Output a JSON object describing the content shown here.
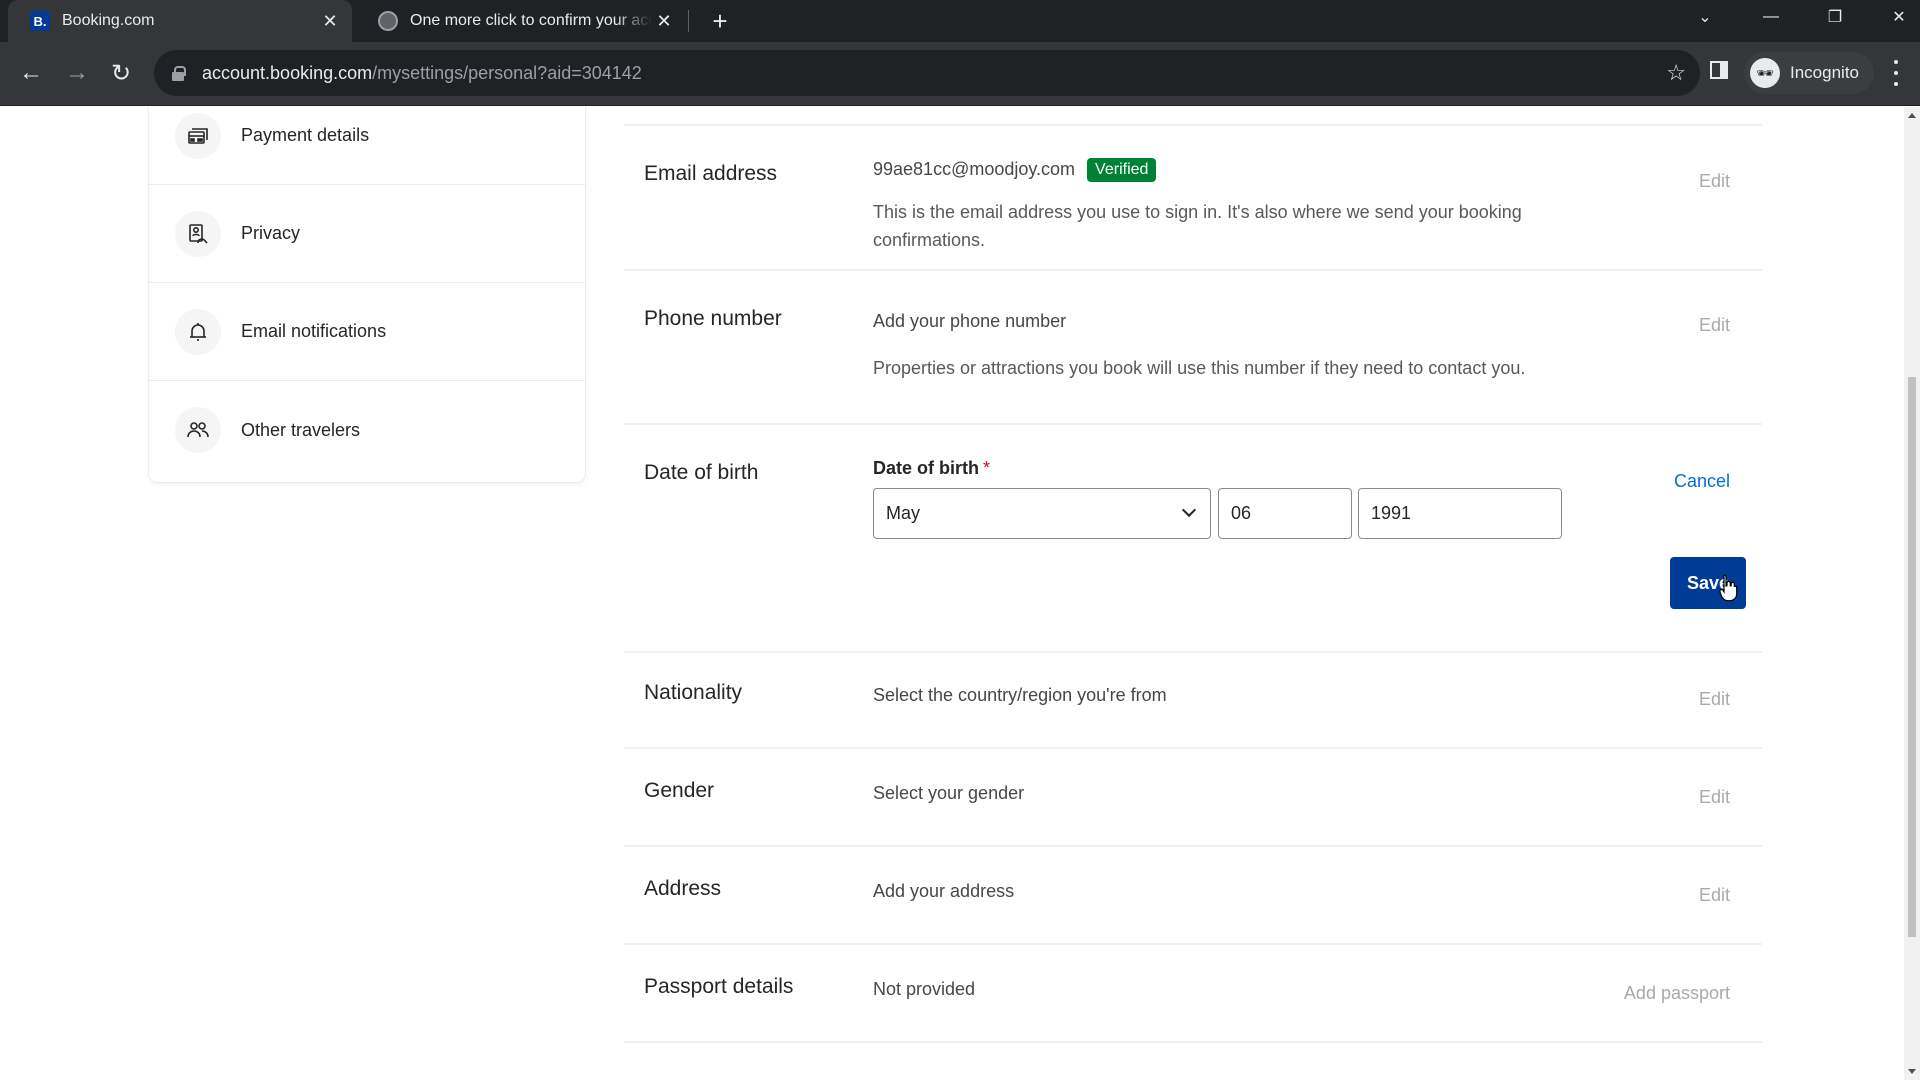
{
  "browser": {
    "tabs": [
      {
        "title": "Booking.com",
        "favicon": "B.",
        "active": true
      },
      {
        "title": "One more click to confirm your account",
        "favicon": "globe-icon",
        "active": false
      }
    ],
    "url_host": "account.booking.com",
    "url_path": "/mysettings/personal?aid=304142",
    "profile_label": "Incognito"
  },
  "sidebar": {
    "items": [
      {
        "label": "Payment details",
        "icon": "credit-card-icon"
      },
      {
        "label": "Privacy",
        "icon": "privacy-icon"
      },
      {
        "label": "Email notifications",
        "icon": "bell-icon"
      },
      {
        "label": "Other travelers",
        "icon": "people-icon"
      }
    ]
  },
  "personal": {
    "email": {
      "label": "Email address",
      "value": "99ae81cc@moodjoy.com",
      "badge": "Verified",
      "description": "This is the email address you use to sign in. It's also where we send your booking confirmations.",
      "action": "Edit"
    },
    "phone": {
      "label": "Phone number",
      "value": "Add your phone number",
      "description": "Properties or attractions you book will use this number if they need to contact you.",
      "action": "Edit"
    },
    "dob": {
      "label": "Date of birth",
      "field_label": "Date of birth",
      "required_mark": "*",
      "month": "May",
      "day": "06",
      "year": "1991",
      "cancel": "Cancel",
      "save": "Save"
    },
    "nationality": {
      "label": "Nationality",
      "value": "Select the country/region you're from",
      "action": "Edit"
    },
    "gender": {
      "label": "Gender",
      "value": "Select your gender",
      "action": "Edit"
    },
    "address": {
      "label": "Address",
      "value": "Add your address",
      "action": "Edit"
    },
    "passport": {
      "label": "Passport details",
      "value": "Not provided",
      "action": "Add passport"
    }
  },
  "colors": {
    "brand_blue": "#003b95",
    "link_blue": "#006ce4",
    "verified_green": "#008234",
    "required_red": "#d4111e"
  }
}
